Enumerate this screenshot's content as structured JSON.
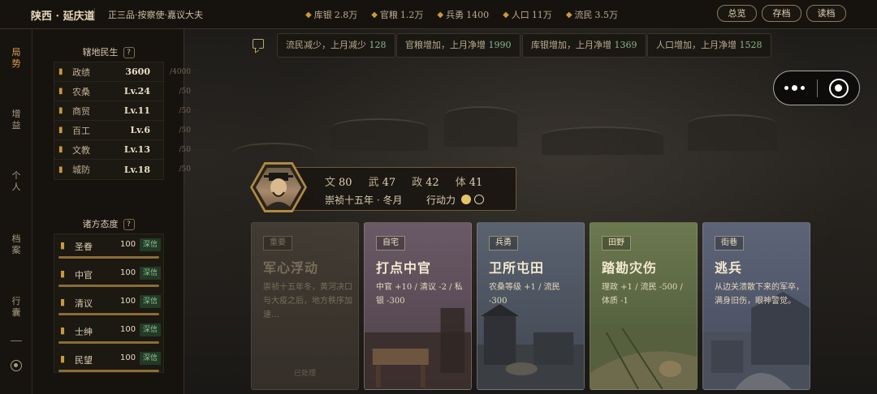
{
  "header": {
    "location": "陕西 · 延庆道",
    "rank": "正三品·按察使·嘉议大夫",
    "stats": [
      {
        "icon": "silver-icon",
        "label": "库银",
        "value": "2.8万"
      },
      {
        "icon": "grain-icon",
        "label": "官粮",
        "value": "1.2万"
      },
      {
        "icon": "soldier-icon",
        "label": "兵勇",
        "value": "1400"
      },
      {
        "icon": "population-icon",
        "label": "人口",
        "value": "11万"
      },
      {
        "icon": "refugee-icon",
        "label": "流民",
        "value": "3.5万"
      }
    ],
    "buttons": {
      "overview": "总览",
      "save": "存档",
      "load": "读档"
    }
  },
  "nav": {
    "items": [
      "局势",
      "增益",
      "个人",
      "档案",
      "行囊"
    ],
    "active": "局势"
  },
  "jurisdiction": {
    "title": "辖地民生",
    "help": "?",
    "rows": [
      {
        "icon": "merit-icon",
        "label": "政绩",
        "value": "3600",
        "max": "/4000"
      },
      {
        "icon": "farm-icon",
        "label": "农桑",
        "value": "Lv.24",
        "max": "/50"
      },
      {
        "icon": "trade-icon",
        "label": "商贸",
        "value": "Lv.11",
        "max": "/50"
      },
      {
        "icon": "craft-icon",
        "label": "百工",
        "value": "Lv.6",
        "max": "/50"
      },
      {
        "icon": "education-icon",
        "label": "文教",
        "value": "Lv.13",
        "max": "/50"
      },
      {
        "icon": "defense-icon",
        "label": "城防",
        "value": "Lv.18",
        "max": "/50"
      }
    ]
  },
  "attitudes": {
    "title": "诸方态度",
    "help": "?",
    "rows": [
      {
        "icon": "emperor-icon",
        "label": "圣眷",
        "value": "100",
        "badge": "深信",
        "level": 1.0
      },
      {
        "icon": "eunuch-icon",
        "label": "中官",
        "value": "100",
        "badge": "深信",
        "level": 1.0
      },
      {
        "icon": "scholar-icon",
        "label": "清议",
        "value": "100",
        "badge": "深信",
        "level": 1.0
      },
      {
        "icon": "gentry-icon",
        "label": "士绅",
        "value": "100",
        "badge": "深信",
        "level": 1.0
      },
      {
        "icon": "people-icon",
        "label": "民望",
        "value": "100",
        "badge": "深信",
        "level": 1.0
      }
    ]
  },
  "news": [
    {
      "text": "流民减少，上月减少",
      "num": "128"
    },
    {
      "text": "官粮增加，上月净增",
      "num": "1990"
    },
    {
      "text": "库银增加，上月净增",
      "num": "1369"
    },
    {
      "text": "人口增加，上月净增",
      "num": "1528"
    }
  ],
  "character": {
    "attrs": [
      {
        "k": "文",
        "v": "80"
      },
      {
        "k": "武",
        "v": "47"
      },
      {
        "k": "政",
        "v": "42"
      },
      {
        "k": "体",
        "v": "41"
      }
    ],
    "date": "崇祯十五年 · 冬月",
    "ap_label": "行动力",
    "ap_current": 1,
    "ap_max": 2
  },
  "cards": [
    {
      "tag": "重要",
      "title": "军心浮动",
      "desc": "崇祯十五年冬，黄河决口与大疫之后，地方秩序加速…",
      "status": "已处理",
      "done": true,
      "color": "#5a5043"
    },
    {
      "tag": "自宅",
      "title": "打点中官",
      "desc": "中官 +10 / 清议 -2 / 私银 -300",
      "status": "",
      "done": false,
      "color": "#5b4a55"
    },
    {
      "tag": "兵勇",
      "title": "卫所屯田",
      "desc": "农桑等级 +1 / 流民 -300",
      "status": "",
      "done": false,
      "color": "#48505a"
    },
    {
      "tag": "田野",
      "title": "踏勘灾伤",
      "desc": "理政 +1 / 流民 -500 / 体质 -1",
      "status": "",
      "done": false,
      "color": "#55603f"
    },
    {
      "tag": "街巷",
      "title": "逃兵",
      "desc": "从边关溃散下来的军卒，满身旧伤，眼神警觉。",
      "status": "",
      "done": false,
      "color": "#4d5567"
    }
  ]
}
